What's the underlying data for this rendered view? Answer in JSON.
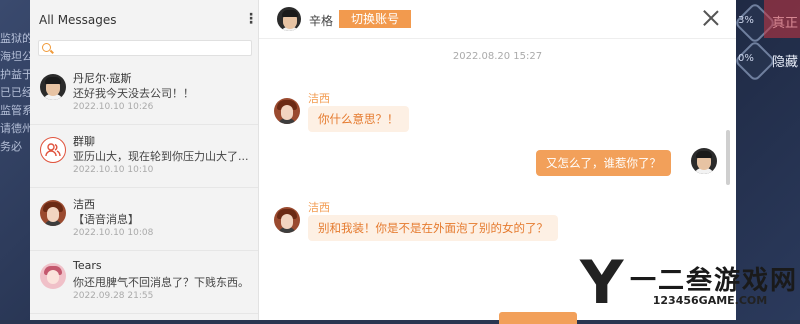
{
  "background": {
    "left_lines": [
      "监狱的",
      "",
      "海坦公",
      "护益于",
      "已已经",
      "监管系",
      "请德州",
      "务必"
    ],
    "right_percents": [
      "3%",
      "0%"
    ],
    "right_labels": [
      "真正",
      "隐藏"
    ]
  },
  "sidebar": {
    "title": "All Messages",
    "more_icon": "more-vertical-icon",
    "search": {
      "placeholder": "",
      "icon": "search-icon"
    },
    "conversations": [
      {
        "name": "丹尼尔·寇斯",
        "message": "还好我今天没去公司！！",
        "time": "2022.10.10 10:26",
        "avatar": "avatar-man"
      },
      {
        "name": "群聊",
        "message": "亚历山大，现在轮到你压力山大了...",
        "time": "2022.10.10 10:10",
        "avatar": "group-icon"
      },
      {
        "name": "洁西",
        "message": "【语音消息】",
        "time": "2022.10.10 10:08",
        "avatar": "avatar-woman"
      },
      {
        "name": "Tears",
        "message": "你还甩脾气不回消息了？下贱东西。",
        "time": "2022.09.28 21:55",
        "avatar": "avatar-girl"
      }
    ]
  },
  "chat": {
    "header": {
      "name": "辛格",
      "switch_label": "切换账号"
    },
    "date": "2022.08.20 15:27",
    "messages": [
      {
        "from": "洁西",
        "side": "in",
        "text": "你什么意思？！"
      },
      {
        "from": "辛格",
        "side": "out",
        "text": "又怎么了，谁惹你了？"
      },
      {
        "from": "洁西",
        "side": "in",
        "text": "别和我装！你是不是在外面泡了别的女的了？"
      }
    ]
  },
  "watermark": {
    "letter": "Y",
    "name": "一二叁游戏网",
    "site": "123456GAME.COM"
  },
  "colors": {
    "accent": "#f29a4e",
    "bubble_in_bg": "#fdf0e4",
    "bubble_in_text": "#e57a2e"
  }
}
